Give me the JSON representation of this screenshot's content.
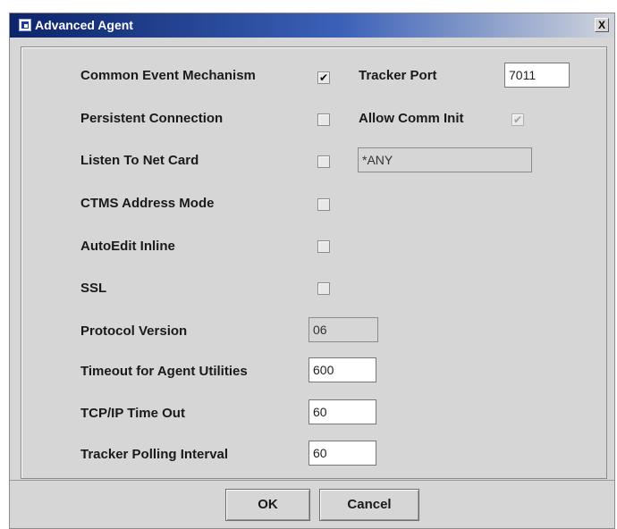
{
  "window": {
    "title": "Advanced Agent",
    "close_glyph": "X"
  },
  "settings": {
    "common_event_mechanism": {
      "label": "Common Event Mechanism",
      "checked": true,
      "glyph": "✔"
    },
    "tracker_port": {
      "label": "Tracker Port",
      "value": "7011"
    },
    "persistent_connection": {
      "label": "Persistent Connection",
      "checked": false
    },
    "allow_comm_init": {
      "label": "Allow Comm Init",
      "checked": true,
      "enabled": false,
      "glyph": "✔"
    },
    "listen_to_net_card": {
      "label": "Listen To Net Card",
      "checked": false,
      "value": "*ANY"
    },
    "ctms_address_mode": {
      "label": "CTMS Address Mode",
      "checked": false
    },
    "autoedit_inline": {
      "label": "AutoEdit Inline",
      "checked": false
    },
    "ssl": {
      "label": "SSL",
      "checked": false
    },
    "protocol_version": {
      "label": "Protocol Version",
      "value": "06"
    },
    "timeout_agent_utilities": {
      "label": "Timeout for Agent Utilities",
      "value": "600"
    },
    "tcpip_timeout": {
      "label": "TCP/IP Time Out",
      "value": "60"
    },
    "tracker_polling_interval": {
      "label": "Tracker Polling Interval",
      "value": "60"
    }
  },
  "buttons": {
    "ok": "OK",
    "cancel": "Cancel"
  },
  "colors": {
    "titlebar_start": "#0c246a",
    "titlebar_end": "#d0d4dc",
    "dialog_bg": "#d6d6d6"
  }
}
